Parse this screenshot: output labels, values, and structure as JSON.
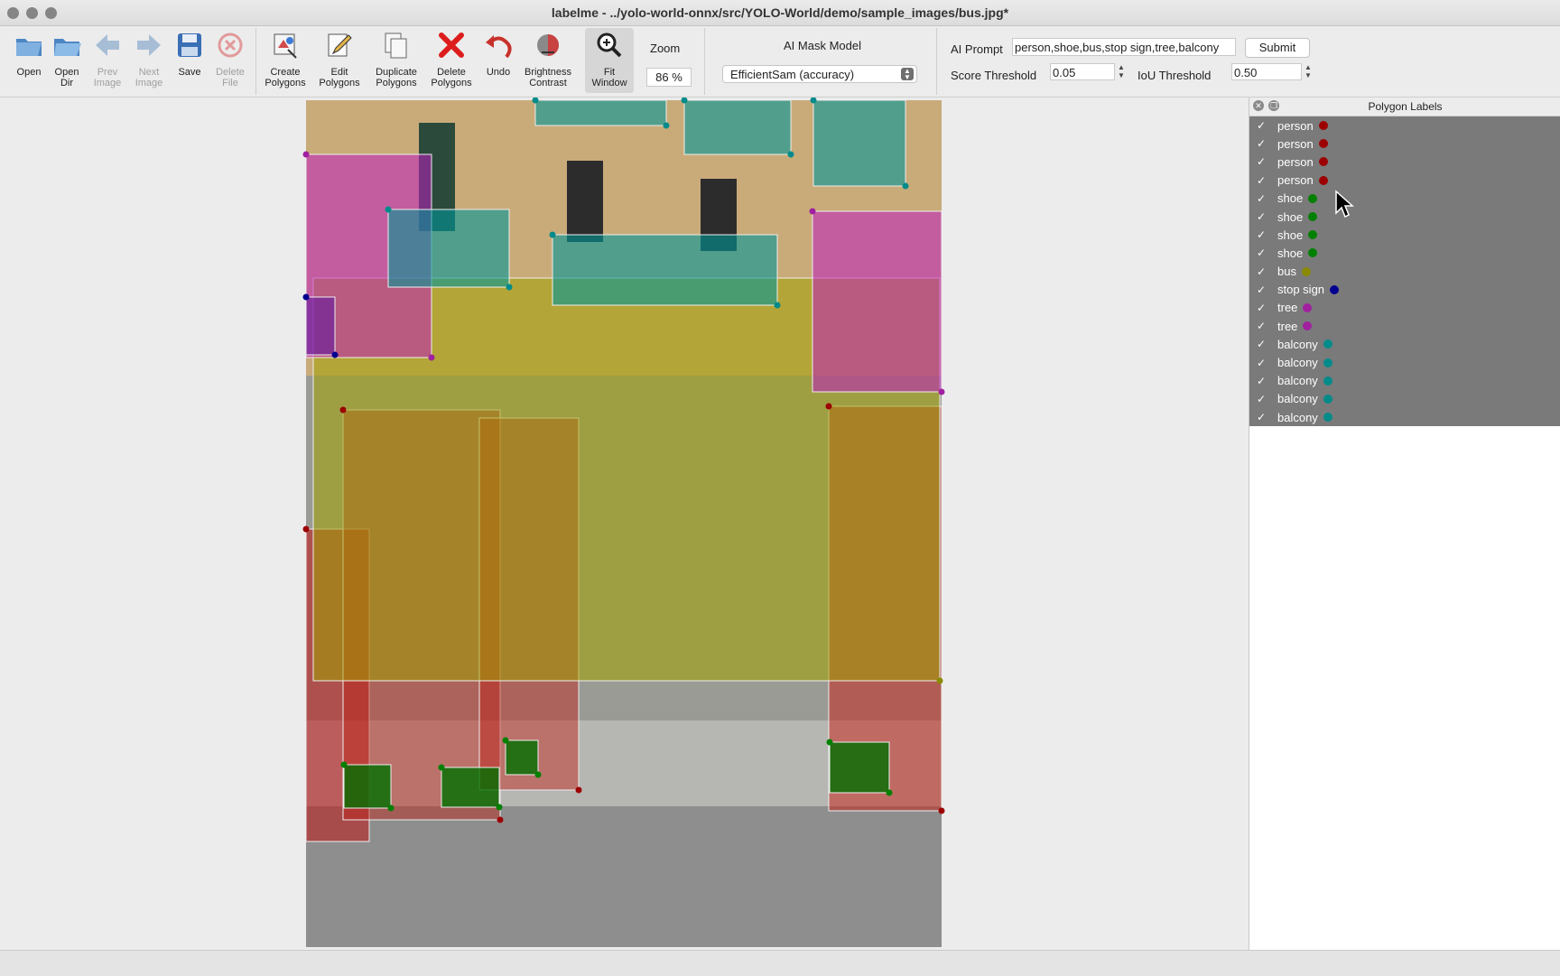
{
  "window": {
    "title": "labelme - ../yolo-world-onnx/src/YOLO-World/demo/sample_images/bus.jpg*"
  },
  "toolbar": {
    "open": "Open",
    "open_dir_1": "Open",
    "open_dir_2": "Dir",
    "prev_1": "Prev",
    "prev_2": "Image",
    "next_1": "Next",
    "next_2": "Image",
    "save": "Save",
    "delete_file_1": "Delete",
    "delete_file_2": "File",
    "create_1": "Create",
    "create_2": "Polygons",
    "edit_1": "Edit",
    "edit_2": "Polygons",
    "dup_1": "Duplicate",
    "dup_2": "Polygons",
    "del_poly_1": "Delete",
    "del_poly_2": "Polygons",
    "undo": "Undo",
    "bright_1": "Brightness",
    "bright_2": "Contrast",
    "fit_1": "Fit",
    "fit_2": "Window",
    "zoom_label": "Zoom",
    "zoom_value": "86 %",
    "mask_label": "AI Mask Model",
    "mask_value": "EfficientSam (accuracy)",
    "ai_prompt_label": "AI Prompt",
    "ai_prompt_value": "person,shoe,bus,stop sign,tree,balcony",
    "submit": "Submit",
    "score_label": "Score Threshold",
    "score_value": "0.05",
    "iou_label": "IoU Threshold",
    "iou_value": "0.50"
  },
  "panel": {
    "title": "Polygon Labels",
    "items": [
      {
        "label": "person",
        "color": "#9c0000"
      },
      {
        "label": "person",
        "color": "#9c0000"
      },
      {
        "label": "person",
        "color": "#9c0000"
      },
      {
        "label": "person",
        "color": "#9c0000"
      },
      {
        "label": "shoe",
        "color": "#008000"
      },
      {
        "label": "shoe",
        "color": "#008000"
      },
      {
        "label": "shoe",
        "color": "#008000"
      },
      {
        "label": "shoe",
        "color": "#008000"
      },
      {
        "label": "bus",
        "color": "#8a8a00"
      },
      {
        "label": "stop sign",
        "color": "#000090"
      },
      {
        "label": "tree",
        "color": "#a020a0"
      },
      {
        "label": "tree",
        "color": "#a020a0"
      },
      {
        "label": "balcony",
        "color": "#008b8b"
      },
      {
        "label": "balcony",
        "color": "#008b8b"
      },
      {
        "label": "balcony",
        "color": "#008b8b"
      },
      {
        "label": "balcony",
        "color": "#008b8b"
      },
      {
        "label": "balcony",
        "color": "#008b8b"
      }
    ]
  }
}
